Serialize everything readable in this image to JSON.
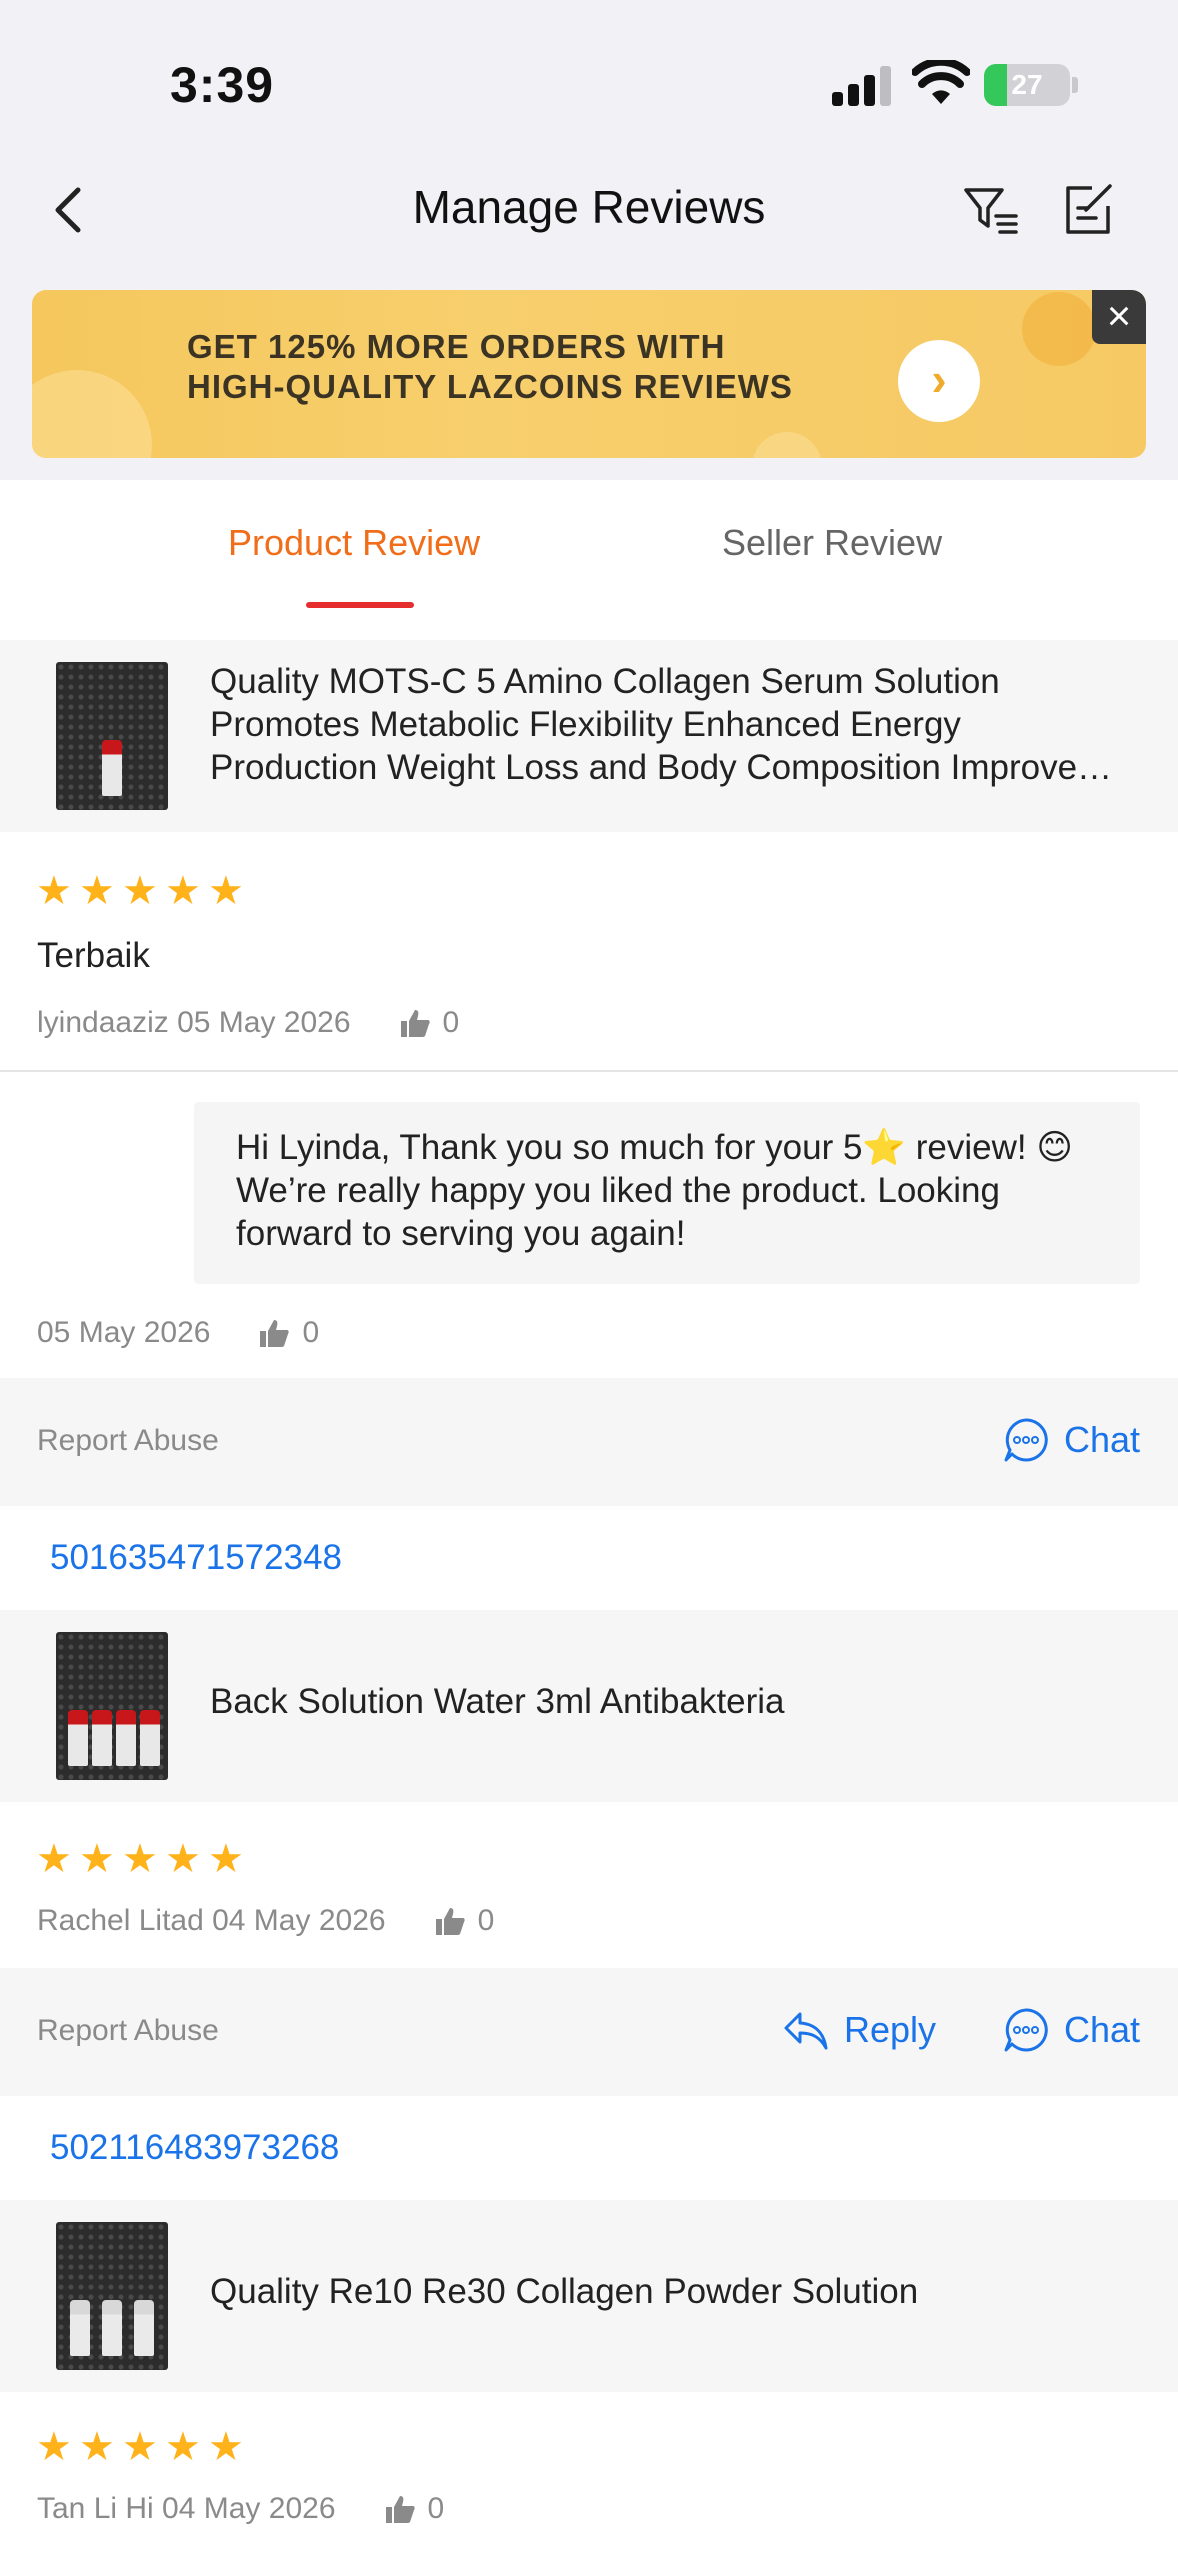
{
  "status_bar": {
    "time": "3:39",
    "battery": "27",
    "battery_level": 0.27
  },
  "nav": {
    "title": "Manage Reviews"
  },
  "banner": {
    "line1": "GET 125% MORE ORDERS WITH",
    "line2": "HIGH-QUALITY LAZCOINS REVIEWS",
    "arrow": "›",
    "close": "×"
  },
  "tabs": {
    "product": "Product Review",
    "seller": "Seller Review",
    "active": "product"
  },
  "reviews": [
    {
      "product_name_line1": "Quality MOTS-C 5 Amino Collagen Serum Solution",
      "product_name_line2": "Promotes Metabolic Flexibility Enhanced Energy",
      "product_name_line3": "Production Weight Loss and Body Composition Improvements",
      "rating": 5,
      "text": "Terbaik",
      "meta": "lyindaaziz 05 May 2026",
      "likes": "0",
      "seller_reply": {
        "text": "Hi Lyinda, Thank you so much for your 5⭐ review! 😊 We’re really happy you liked the product. Looking forward to serving you again!",
        "date": "05 May 2026",
        "likes": "0"
      },
      "report": "Report Abuse",
      "chat": "Chat"
    },
    {
      "order_id": "501635471572348",
      "product_name": "Back Solution Water 3ml Antibakteria",
      "rating": 5,
      "meta": "Rachel Litad 04 May 2026",
      "likes": "0",
      "report": "Report Abuse",
      "reply": "Reply",
      "chat": "Chat"
    },
    {
      "order_id": "502116483973268",
      "product_name": "Quality Re10 Re30 Collagen Powder Solution",
      "rating": 5,
      "meta": "Tan Li Hi 04 May 2026",
      "likes": "0"
    }
  ],
  "icons": {
    "back": "chevron-left-icon",
    "filter": "filter-icon",
    "edit": "edit-icon",
    "like": "thumbs-up-icon",
    "chat": "chat-bubble-icon",
    "reply": "reply-arrow-icon",
    "star": "star-icon"
  },
  "colors": {
    "accent": "#f06d1a",
    "tab_indicator": "#e62e2e",
    "link": "#1a73e8",
    "star": "#ffb21a",
    "battery": "#34c759",
    "banner": "#f5c75d"
  }
}
